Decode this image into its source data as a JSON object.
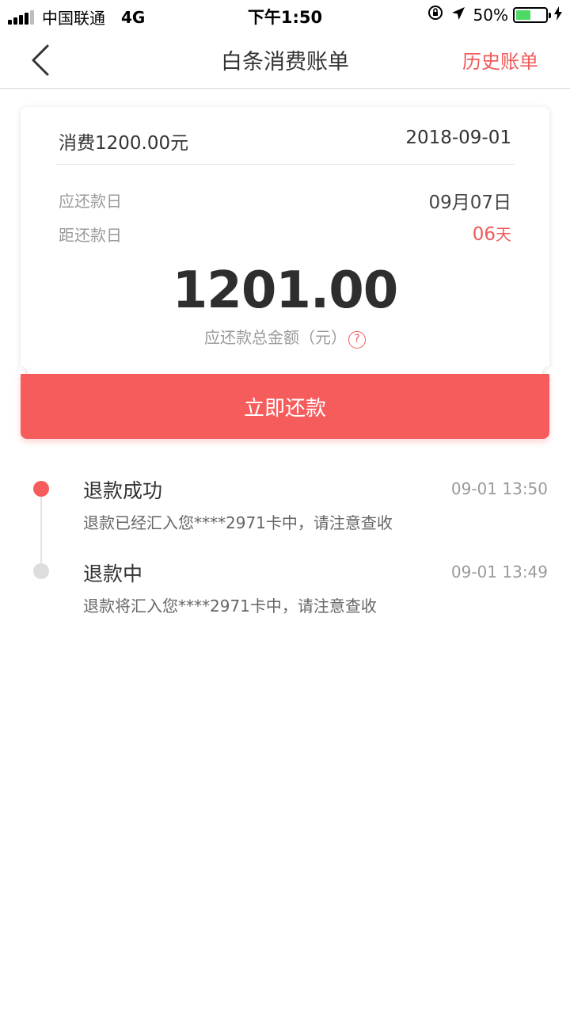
{
  "status_bar": {
    "carrier": "中国联通",
    "network": "4G",
    "time": "下午1:50",
    "battery_percent": "50%",
    "battery_level": 0.5
  },
  "nav": {
    "title": "白条消费账单",
    "history_label": "历史账单"
  },
  "bill": {
    "amount_text": "消费1200.00元",
    "date": "2018-09-01",
    "due_label": "应还款日",
    "due_date": "09月07日",
    "days_label": "距还款日",
    "days_value": "06",
    "days_unit": "天",
    "total": "1201.00",
    "total_label": "应还款总金额（元）",
    "help": "?"
  },
  "pay_button": "立即还款",
  "timeline": [
    {
      "title": "退款成功",
      "time": "09-01 13:50",
      "desc": "退款已经汇入您****2971卡中，请注意查收",
      "active": true
    },
    {
      "title": "退款中",
      "time": "09-01 13:49",
      "desc": "退款将汇入您****2971卡中，请注意查收",
      "active": false
    }
  ],
  "colors": {
    "accent": "#f75c5c",
    "accent_text": "#f05a5a",
    "inactive_dot": "#dddddd",
    "battery": "#4cd964"
  }
}
